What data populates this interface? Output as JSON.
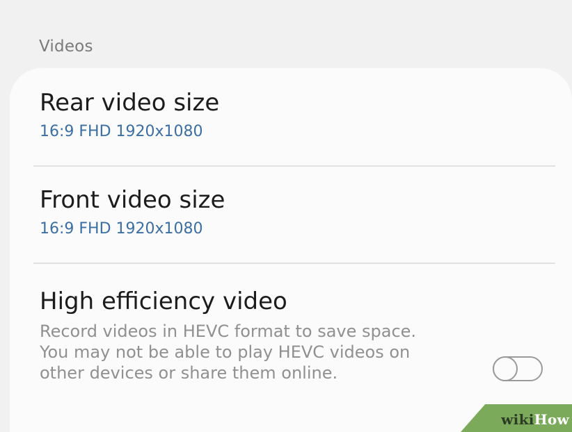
{
  "section": {
    "header": "Videos"
  },
  "settings": [
    {
      "title": "Rear video size",
      "value": "16:9 FHD 1920x1080"
    },
    {
      "title": "Front video size",
      "value": "16:9 FHD 1920x1080"
    },
    {
      "title": "High efficiency video",
      "description": "Record videos in HEVC format to save space. You may not be able to play HEVC videos on other devices or share them online.",
      "toggle_on": false
    }
  ],
  "watermark": {
    "part1": "wiki",
    "part2": "How"
  },
  "colors": {
    "background": "#f1f1f1",
    "card": "#fbfbfb",
    "value_blue": "#3b6fa3",
    "watermark_green": "#7bab5a"
  }
}
